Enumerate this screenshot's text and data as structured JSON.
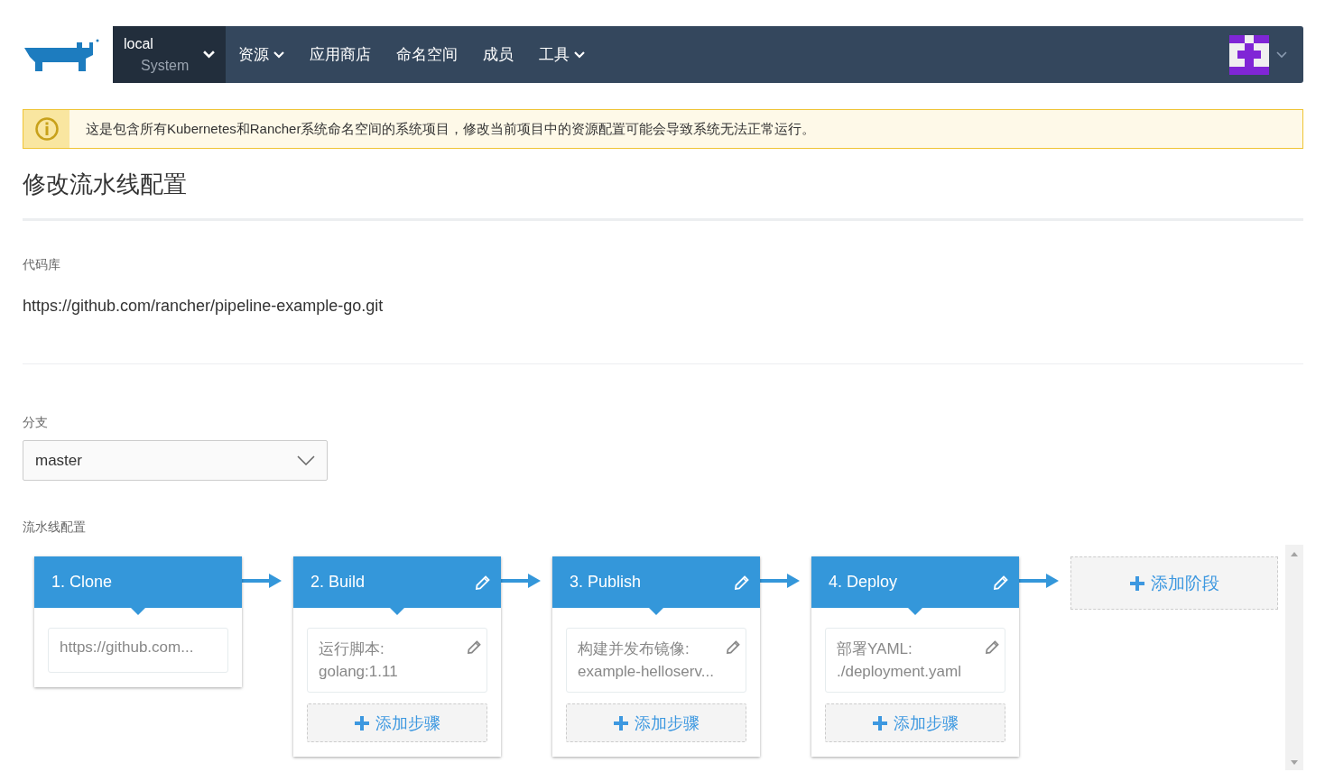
{
  "nav": {
    "cluster": "local",
    "project": "System",
    "menu": [
      {
        "label": "资源",
        "dropdown": true
      },
      {
        "label": "应用商店",
        "dropdown": false
      },
      {
        "label": "命名空间",
        "dropdown": false
      },
      {
        "label": "成员",
        "dropdown": false
      },
      {
        "label": "工具",
        "dropdown": true
      }
    ]
  },
  "alert": {
    "text": "这是包含所有Kubernetes和Rancher系统命名空间的系统项目，修改当前项目中的资源配置可能会导致系统无法正常运行。"
  },
  "title": "修改流水线配置",
  "repository": {
    "label": "代码库",
    "value": "https://github.com/rancher/pipeline-example-go.git"
  },
  "branch": {
    "label": "分支",
    "value": "master"
  },
  "pipeline": {
    "label": "流水线配置",
    "stages": [
      {
        "title": "1. Clone",
        "editable": false,
        "steps": [
          {
            "value": "https://github.com...",
            "editable": false
          }
        ]
      },
      {
        "title": "2. Build",
        "editable": true,
        "steps": [
          {
            "label": "运行脚本:",
            "value": "golang:1.11",
            "editable": true
          }
        ],
        "add_step": "添加步骤"
      },
      {
        "title": "3. Publish",
        "editable": true,
        "steps": [
          {
            "label": "构建并发布镜像:",
            "value": "example-helloserv...",
            "editable": true
          }
        ],
        "add_step": "添加步骤"
      },
      {
        "title": "4. Deploy",
        "editable": true,
        "steps": [
          {
            "label": "部署YAML:",
            "value": "./deployment.yaml",
            "editable": true
          }
        ],
        "add_step": "添加步骤"
      }
    ],
    "add_stage": "添加阶段"
  }
}
